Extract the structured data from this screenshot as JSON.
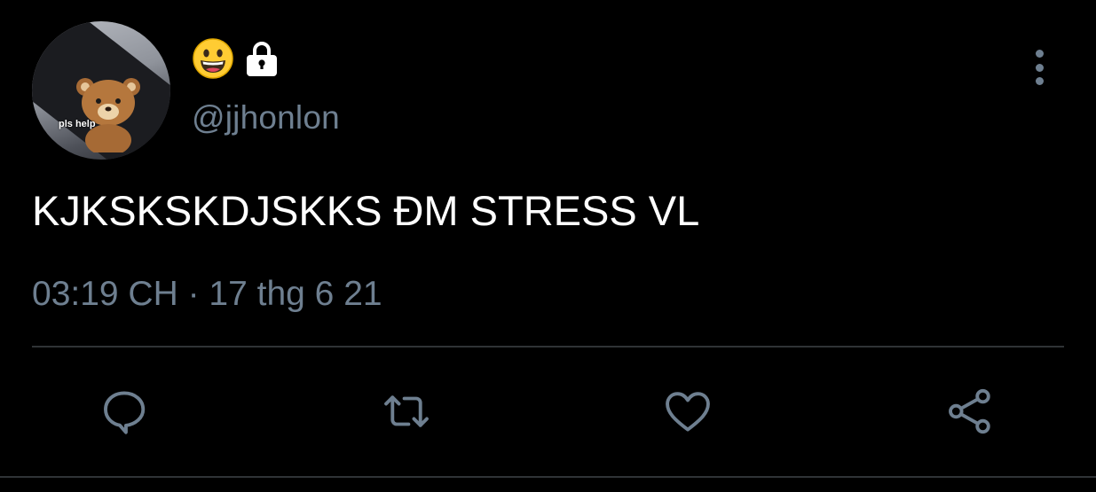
{
  "user": {
    "avatar_text": "pls help",
    "display_name_icons": [
      "grinning-face-emoji",
      "lock-icon"
    ],
    "handle": "@jjhonlon"
  },
  "tweet": {
    "text": "KJKSKSKDJSKKS ĐM STRESS VL",
    "timestamp": "03:19 CH · 17 thg 6 21"
  },
  "actions": [
    "reply-icon",
    "retweet-icon",
    "like-icon",
    "share-icon"
  ],
  "colors": {
    "background": "#000000",
    "text": "#ffffff",
    "muted": "#6e7f90",
    "divider": "#2f3336"
  }
}
